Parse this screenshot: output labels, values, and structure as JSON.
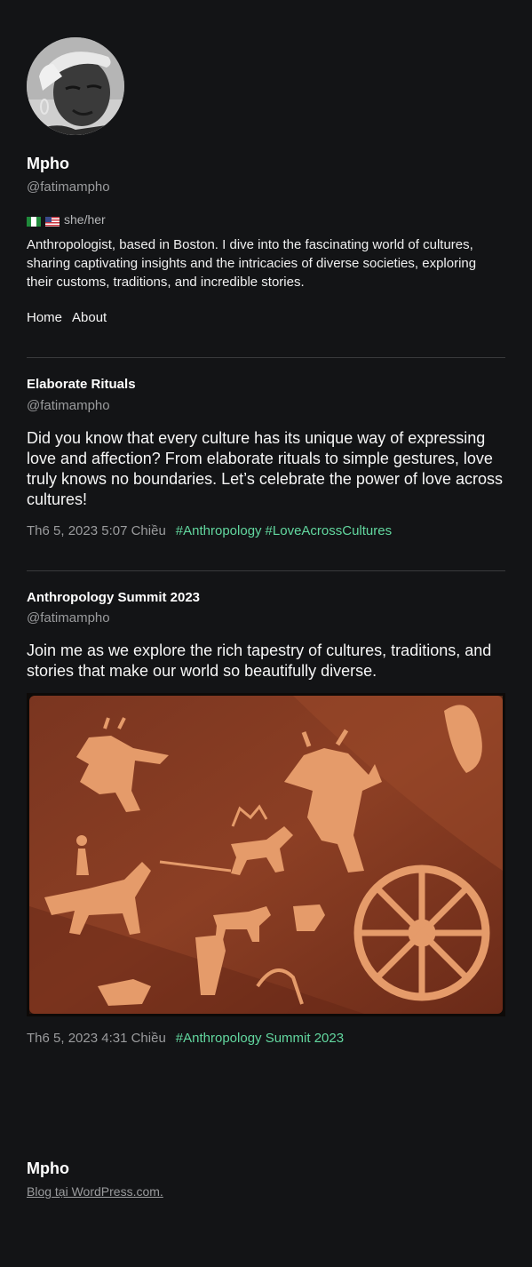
{
  "profile": {
    "name": "Mpho",
    "handle": "@fatimampho",
    "pronouns": "she/her",
    "flags": [
      "nigeria-flag-icon",
      "us-flag-icon"
    ],
    "bio": "Anthropologist, based in Boston. I dive into the fascinating world of cultures, sharing captivating insights and the intricacies of diverse societies, exploring their customs, traditions, and incredible stories."
  },
  "nav": {
    "home": "Home",
    "about": "About"
  },
  "posts": [
    {
      "title": "Elaborate Rituals",
      "handle": "@fatimampho",
      "text": "Did you know that every culture has its unique way of expressing love and affection? From elaborate rituals to simple gestures, love truly knows no boundaries. Let’s celebrate the power of love across cultures!",
      "date": "Th6 5, 2023 5:07 Chiều",
      "tags": [
        "#Anthropology",
        "#LoveAcrossCultures"
      ]
    },
    {
      "title": "Anthropology Summit 2023",
      "handle": "@fatimampho",
      "text": "Join me as we explore the rich tapestry of cultures, traditions, and stories that make our world so beautifully diverse.",
      "date": "Th6 5, 2023 4:31 Chiều",
      "tags": [
        "#Anthropology Summit 2023"
      ]
    }
  ],
  "footer": {
    "name": "Mpho",
    "link": "Blog tại WordPress.com."
  },
  "colors": {
    "background": "#131416",
    "accent": "#62d79f",
    "muted": "#9a9b9d"
  }
}
